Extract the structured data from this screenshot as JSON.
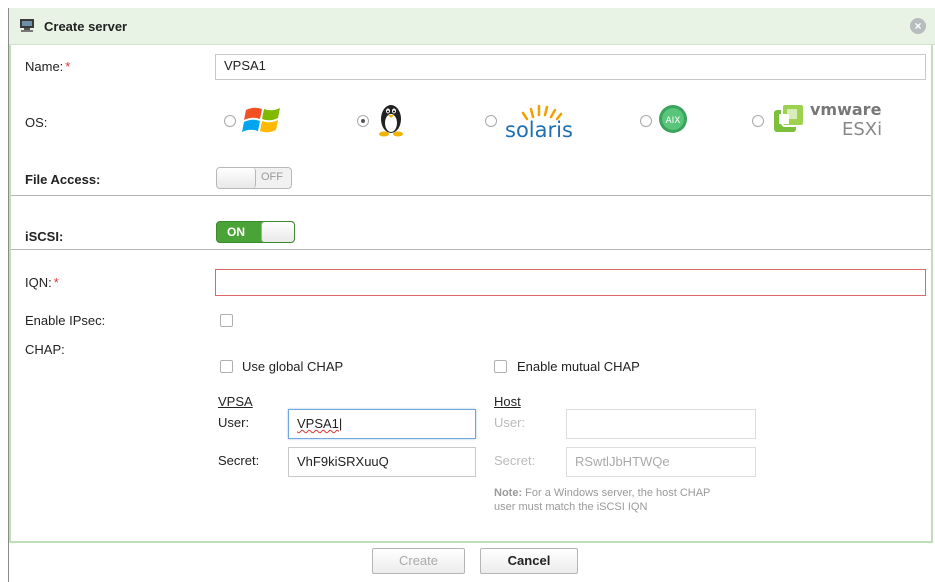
{
  "dialog": {
    "title": "Create server",
    "title_icon": "server-icon",
    "close_icon": "close-icon"
  },
  "fields": {
    "name_label": "Name:",
    "name_required": "*",
    "name_value": "VPSA1",
    "os_label": "OS:",
    "os_options": [
      {
        "name": "windows",
        "icon": "windows-logo-icon",
        "checked": false
      },
      {
        "name": "linux",
        "icon": "linux-tux-icon",
        "checked": true
      },
      {
        "name": "solaris",
        "icon": "solaris-logo-icon",
        "checked": false,
        "text": "solaris"
      },
      {
        "name": "aix",
        "icon": "aix-logo-icon",
        "checked": false,
        "text": "AIX"
      },
      {
        "name": "vmware-esxi",
        "icon": "vmware-esxi-logo-icon",
        "checked": false,
        "text_top": "vmware",
        "text_bottom": "ESXi"
      }
    ],
    "file_access_label": "File Access:",
    "file_access_toggle": "OFF",
    "iscsi_label": "iSCSI:",
    "iscsi_toggle": "ON",
    "iqn_label": "IQN:",
    "iqn_required": "*",
    "iqn_value": "",
    "ipsec_label": "Enable IPsec:",
    "chap_label": "CHAP:",
    "use_global_chap": "Use global CHAP",
    "enable_mutual_chap": "Enable mutual CHAP"
  },
  "vpsa": {
    "heading": "VPSA",
    "user_label": "User:",
    "user_value": "VPSA1",
    "secret_label": "Secret:",
    "secret_value": "VhF9kiSRXuuQ"
  },
  "host": {
    "heading": "Host",
    "user_label": "User:",
    "user_value": "",
    "secret_label": "Secret:",
    "secret_value": "RSwtlJbHTWQe",
    "note_bold": "Note:",
    "note_line1": " For a Windows server, the host CHAP",
    "note_line2": "user must match the iSCSI IQN"
  },
  "buttons": {
    "create": "Create",
    "cancel": "Cancel"
  },
  "colors": {
    "title_bg": "#e8f3e5",
    "toggle_on": "#4aa336",
    "required": "#d33333",
    "error_border": "#d66666"
  }
}
